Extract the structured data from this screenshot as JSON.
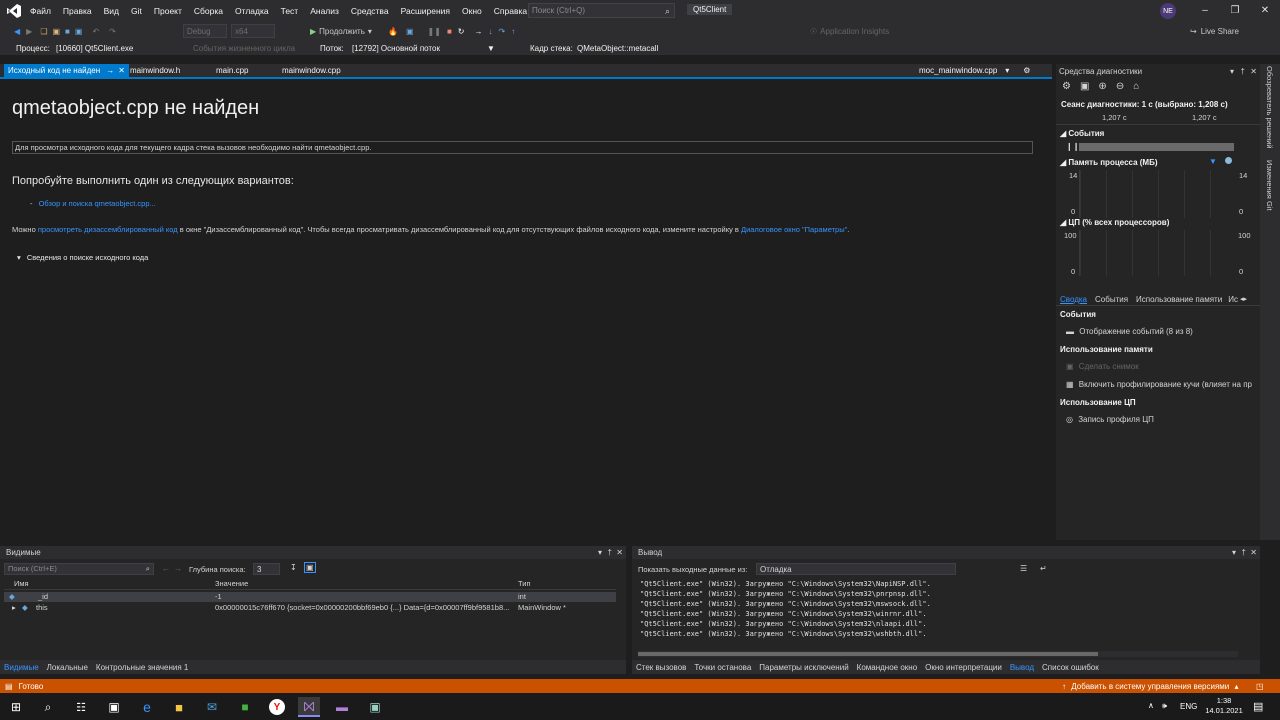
{
  "menu": {
    "items": [
      "Файл",
      "Правка",
      "Вид",
      "Git",
      "Проект",
      "Сборка",
      "Отладка",
      "Тест",
      "Анализ",
      "Средства",
      "Расширения",
      "Окно",
      "Справка"
    ],
    "search_placeholder": "Поиск (Ctrl+Q)",
    "solution": "Qt5Client",
    "avatar": "NE"
  },
  "toolbar": {
    "config": "Debug",
    "platform": "x64",
    "continue_label": "Продолжить",
    "app_insights": "Application Insights",
    "live_share": "Live Share"
  },
  "procbar": {
    "process_label": "Процесс:",
    "process_value": "[10660] Qt5Client.exe",
    "lifecycle": "События жизненного цикла",
    "thread_label": "Поток:",
    "thread_value": "[12792] Основной поток",
    "frame_label": "Кадр стека:",
    "frame_value": "QMetaObject::metacall"
  },
  "tabs": {
    "active": "Исходный код не найден",
    "items": [
      "mainwindow.h",
      "main.cpp",
      "mainwindow.cpp"
    ],
    "right": "moc_mainwindow.cpp"
  },
  "doc": {
    "title": "qmetaobject.cpp не найден",
    "notice": "Для просмотра исходного кода для текущего кадра стека вызовов необходимо найти qmetaobject.cpp.",
    "try": "Попробуйте выполнить один из следующих вариантов:",
    "browse_bullet": "-",
    "browse": "Обзор и поиска qmetaobject.cpp...",
    "can_prefix": "Можно",
    "can_link": "просмотреть дизассемблированный код",
    "can_middle": "в окне \"Дизассемблированный код\". Чтобы всегда просматривать дизассемблированный код для отсутствующих файлов исходного кода, измените настройку в",
    "can_link2": "Диалоговое окно \"Параметры\"",
    "can_end": ".",
    "details": "Сведения о поиске исходного кода"
  },
  "diag": {
    "title": "Средства диагностики",
    "session": "Сеанс диагностики: 1 с (выбрано: 1,208 с)",
    "t1": "1,207 с",
    "t2": "1,207 с",
    "events": "События",
    "memory": "Память процесса (МБ)",
    "mem_max": "14",
    "mem_min": "0",
    "cpu": "ЦП (% всех процессоров)",
    "cpu_max": "100",
    "cpu_min": "0",
    "tabs": [
      "Сводка",
      "События",
      "Использование памяти",
      "Ис"
    ],
    "sec_events": "События",
    "events_item": "Отображение событий (8 из 8)",
    "sec_mem": "Использование памяти",
    "snapshot": "Сделать снимок",
    "heap": "Включить профилирование кучи (влияет на пр",
    "sec_cpu": "Использование ЦП",
    "cpu_record": "Запись профиля ЦП"
  },
  "rstrip": {
    "explorer": "Обозреватель решений",
    "git": "Изменения Git"
  },
  "watch": {
    "title": "Видимые",
    "search_placeholder": "Поиск (Ctrl+E)",
    "depth_label": "Глубина поиска:",
    "depth": "3",
    "columns": [
      "Имя",
      "Значение",
      "Тип"
    ],
    "rows": [
      {
        "name": "_id",
        "value": "-1",
        "type": "int"
      },
      {
        "name": "this",
        "value": "0x00000015c76ff670 {socket=0x00000200bbf69eb0 {...} Data={d=0x00007ff9bf9581b8...",
        "type": "MainWindow *"
      }
    ],
    "tabs": [
      "Видимые",
      "Локальные",
      "Контрольные значения 1"
    ]
  },
  "output": {
    "title": "Вывод",
    "show_label": "Показать выходные данные из:",
    "source": "Отладка",
    "lines": [
      "\"Qt5Client.exe\" (Win32). Загружено \"C:\\Windows\\System32\\NapiNSP.dll\".",
      "\"Qt5Client.exe\" (Win32). Загружено \"C:\\Windows\\System32\\pnrpnsp.dll\".",
      "\"Qt5Client.exe\" (Win32). Загружено \"C:\\Windows\\System32\\mswsock.dll\".",
      "\"Qt5Client.exe\" (Win32). Загружено \"C:\\Windows\\System32\\winrnr.dll\".",
      "\"Qt5Client.exe\" (Win32). Загружено \"C:\\Windows\\System32\\nlaapi.dll\".",
      "\"Qt5Client.exe\" (Win32). Загружено \"C:\\Windows\\System32\\wshbth.dll\"."
    ],
    "tabs": [
      "Стек вызовов",
      "Точки останова",
      "Параметры исключений",
      "Командное окно",
      "Окно интерпретации",
      "Вывод",
      "Список ошибок"
    ]
  },
  "status": {
    "ready": "Готово",
    "source_control": "Добавить в систему управления версиями"
  },
  "taskbar": {
    "lang": "ENG",
    "time": "1:38",
    "date": "14.01.2021"
  },
  "colors": {
    "accent": "#007acc",
    "status": "#ca5100",
    "link": "#3794ff"
  }
}
